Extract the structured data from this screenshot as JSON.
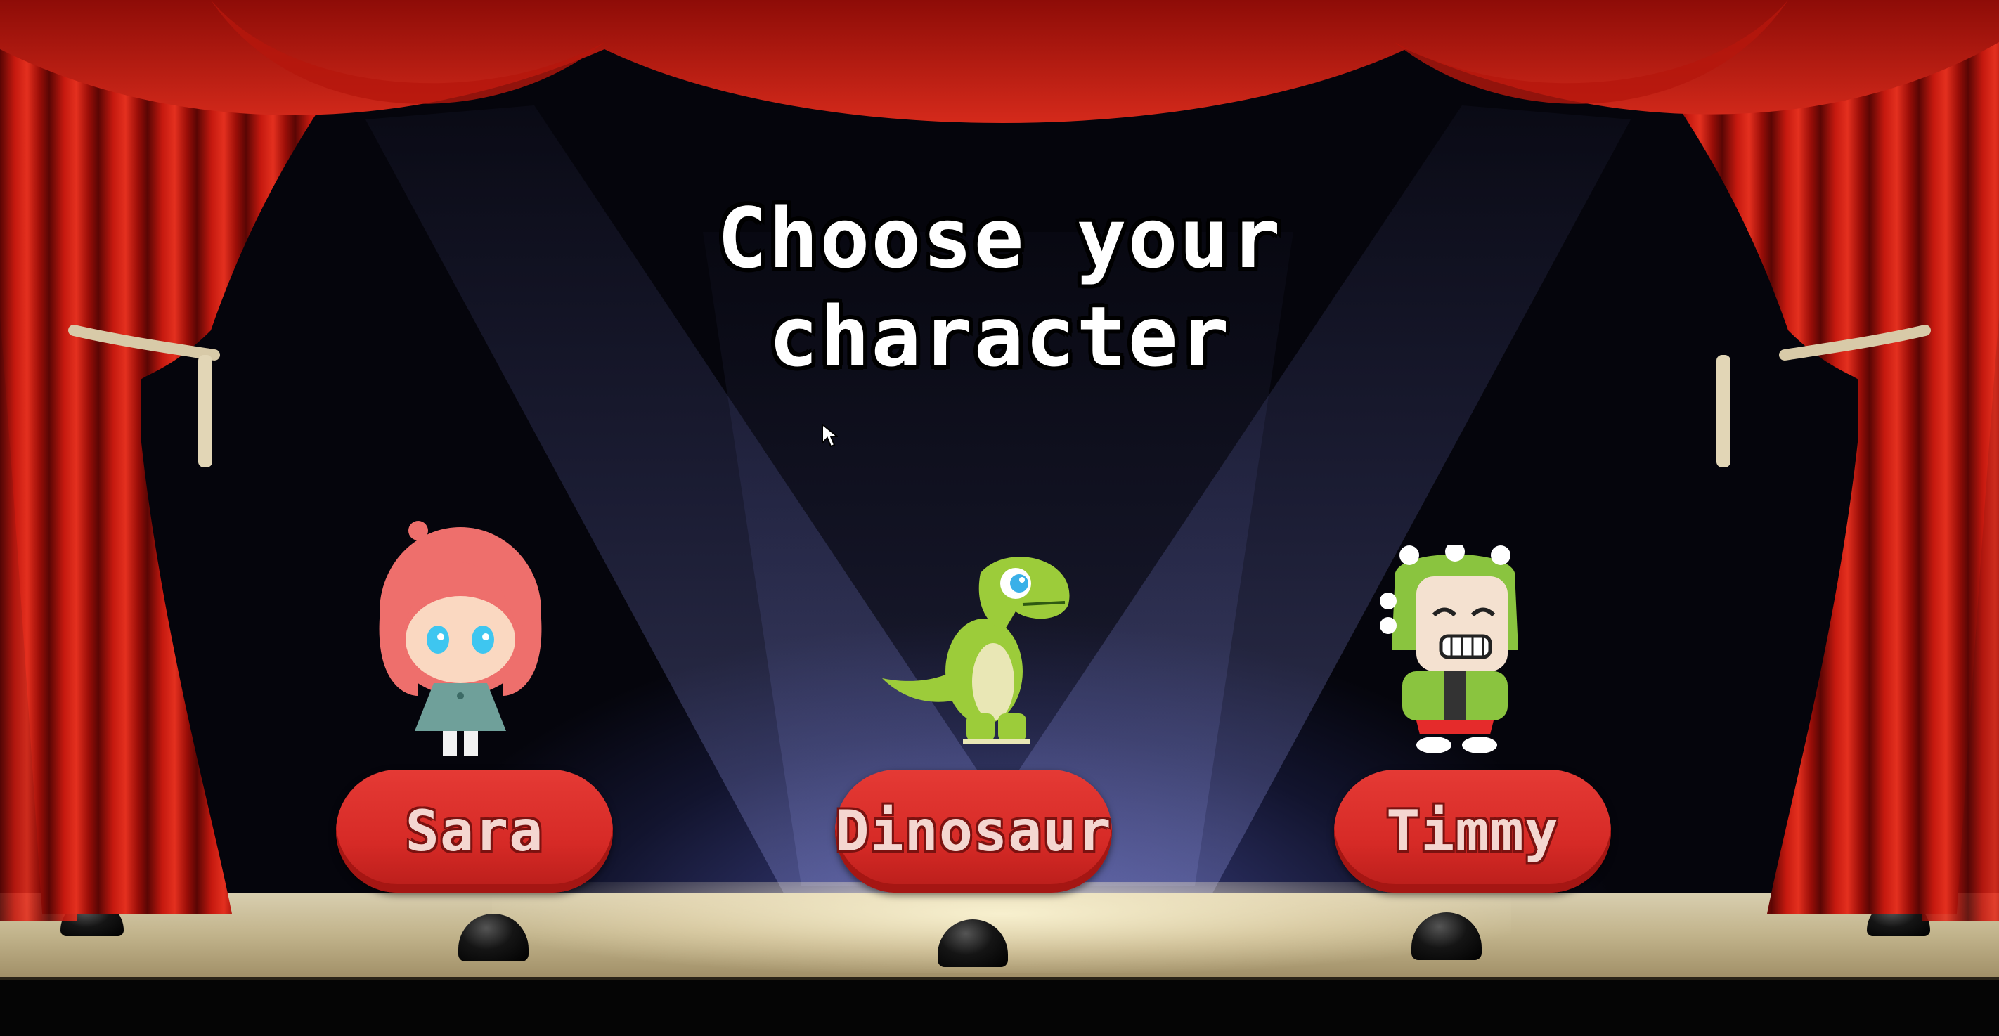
{
  "title": {
    "line1": "Choose your",
    "line2": "character"
  },
  "characters": [
    {
      "name": "Sara",
      "button_label": "Sara",
      "icon": "girl-character-icon"
    },
    {
      "name": "Dinosaur",
      "button_label": "Dinosaur",
      "icon": "dinosaur-character-icon"
    },
    {
      "name": "Timmy",
      "button_label": "Timmy",
      "icon": "boy-in-dino-costume-icon"
    }
  ],
  "colors": {
    "curtain": "#b0150f",
    "button": "#d62a26",
    "button_text": "#f4d6d0",
    "stage_floor": "#c2b48c",
    "background": "#12142e"
  }
}
